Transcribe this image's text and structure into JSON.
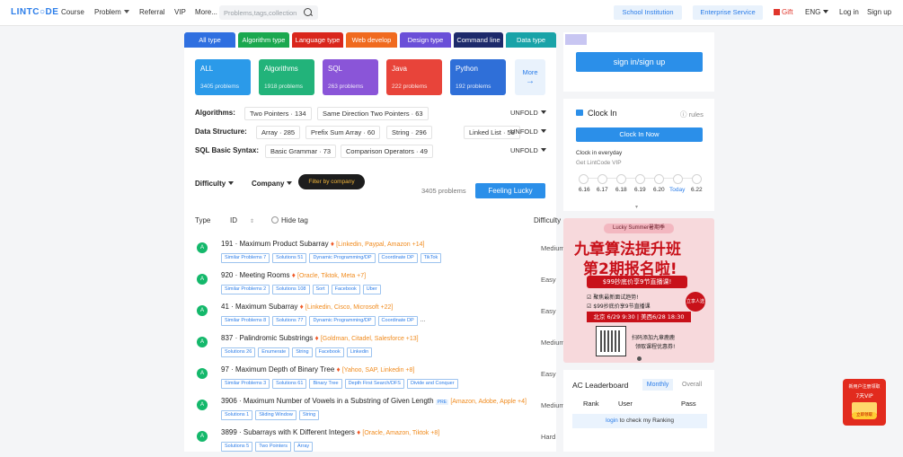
{
  "nav": {
    "logo": "LINTC○DE",
    "course": "Course",
    "problem": "Problem",
    "referral": "Referral",
    "vip": "VIP",
    "more": "More...",
    "search_placeholder": "Problems,tags,collection",
    "school": "School Institution",
    "enterprise": "Enterprise Service",
    "gift": "Gift",
    "lang": "ENG",
    "login": "Log in",
    "signup": "Sign up"
  },
  "type_tabs": [
    {
      "label": "All type",
      "color": "#2f6fe0"
    },
    {
      "label": "Algorithm type",
      "color": "#1aa84f"
    },
    {
      "label": "Language type",
      "color": "#d9261c"
    },
    {
      "label": "Web develop",
      "color": "#f06a1f"
    },
    {
      "label": "Design type",
      "color": "#6a4fd8"
    },
    {
      "label": "Command line",
      "color": "#1d2a6b"
    },
    {
      "label": "Data type",
      "color": "#19a3a8"
    }
  ],
  "cards": [
    {
      "title": "ALL",
      "count": "3405 problems",
      "color": "#2b9ae9"
    },
    {
      "title": "Algorithms",
      "count": "1918 problems",
      "color": "#22b37a"
    },
    {
      "title": "SQL",
      "count": "263 problems",
      "color": "#8a55d8"
    },
    {
      "title": "Java",
      "count": "222 problems",
      "color": "#e8443a"
    },
    {
      "title": "Python",
      "count": "192 problems",
      "color": "#2f6fd8"
    }
  ],
  "more_card": "More",
  "filter_rows": {
    "algorithms": {
      "label": "Algorithms:",
      "chips": [
        "Two Pointers · 134",
        "Same Direction Two Pointers · 63"
      ]
    },
    "data_structure": {
      "label": "Data Structure:",
      "chips": [
        "Array · 285",
        "Prefix Sum Array · 60",
        "String · 296",
        "Linked List · 58"
      ]
    },
    "sql_basic": {
      "label": "SQL Basic Syntax:",
      "chips": [
        "Basic Grammar · 73",
        "Comparison Operators · 49"
      ]
    },
    "unfold": "UNFOLD"
  },
  "filters": {
    "difficulty": "Difficulty",
    "company": "Company",
    "filter_by_company": "Filter by company",
    "count": "3405 problems",
    "feeling_lucky": "Feeling Lucky"
  },
  "table_header": {
    "type": "Type",
    "id": "ID",
    "hide_tag": "Hide tag",
    "difficulty": "Difficulty"
  },
  "problems": [
    {
      "avatar": "A",
      "title": "191 · Maximum Product Subarray",
      "companies": "[Linkedin, Paypal, Amazon +14]",
      "tags": [
        "Similar Problems 7",
        "Solutions 51",
        "Dynamic Programming/DP",
        "Coordinate DP",
        "TikTok"
      ],
      "difficulty": "Medium"
    },
    {
      "avatar": "A",
      "title": "920 · Meeting Rooms",
      "companies": "[Oracle, Tiktok, Meta +7]",
      "tags": [
        "Similar Problems 2",
        "Solutions 108",
        "Sort",
        "Facebook",
        "Uber"
      ],
      "difficulty": "Easy"
    },
    {
      "avatar": "A",
      "title": "41 · Maximum Subarray",
      "companies": "[Linkedin, Cisco, Microsoft +22]",
      "tags": [
        "Similar Problems 8",
        "Solutions 77",
        "Dynamic Programming/DP",
        "Coordinate DP"
      ],
      "tags_more": "...",
      "difficulty": "Easy"
    },
    {
      "avatar": "A",
      "title": "837 · Palindromic Substrings",
      "companies": "[Goldman, Citadel, Salesforce +13]",
      "tags": [
        "Solutions 26",
        "Enumerate",
        "String",
        "Facebook",
        "Linkedin"
      ],
      "difficulty": "Medium"
    },
    {
      "avatar": "A",
      "title": "97 · Maximum Depth of Binary Tree",
      "companies": "[Yahoo, SAP, Linkedin +8]",
      "tags": [
        "Similar Problems 3",
        "Solutions 61",
        "Binary Tree",
        "Depth First Search/DFS",
        "Divide and Conquer"
      ],
      "difficulty": "Easy"
    },
    {
      "avatar": "A",
      "title": "3906 · Maximum Number of Vowels in a Substring of Given Length",
      "badge": "PRE",
      "companies": "[Amazon, Adobe, Apple +4]",
      "tags": [
        "Solutions 1",
        "Sliding Window",
        "String"
      ],
      "difficulty": "Medium"
    },
    {
      "avatar": "A",
      "title": "3899 · Subarrays with K Different Integers",
      "companies": "[Oracle, Amazon, Tiktok +8]",
      "tags": [
        "Solutions 5",
        "Two Pointers",
        "Array"
      ],
      "difficulty": "Hard"
    }
  ],
  "side": {
    "signin": "sign in/sign up",
    "clockin_title": "Clock In",
    "rules": "rules",
    "clockin_now": "Clock In Now",
    "everyday": "Clock in everyday",
    "get_vip": "Get LintCode VIP",
    "dates": [
      "6.16",
      "6.17",
      "6.18",
      "6.19",
      "6.20",
      "Today",
      "6.22"
    ]
  },
  "ad": {
    "ribbon": "Lucky Summer暑期季",
    "title1": "九章算法提升班",
    "title2": "第2期报名啦!",
    "price": "$99抄底价享9节直播课!",
    "bullet1": "聚焦最新面试趋势!",
    "bullet2": "$99抄底价享9节直播课",
    "badge": "立享人选",
    "time": "北京 6/29 9:30 | 美西6/28 18:30",
    "qr1": "扫码添加九章鹿鹿",
    "qr2": "领取课程优惠券!"
  },
  "leaderboard": {
    "title": "AC Leaderboard",
    "monthly": "Monthly",
    "overall": "Overall",
    "cols": [
      "Rank",
      "User",
      "Pass"
    ],
    "login_link": "login",
    "login_rest": " to check my Ranking"
  },
  "float_ad": {
    "line1": "新用户注册领取",
    "line2": "7天VIP",
    "btn": "立即领取"
  }
}
